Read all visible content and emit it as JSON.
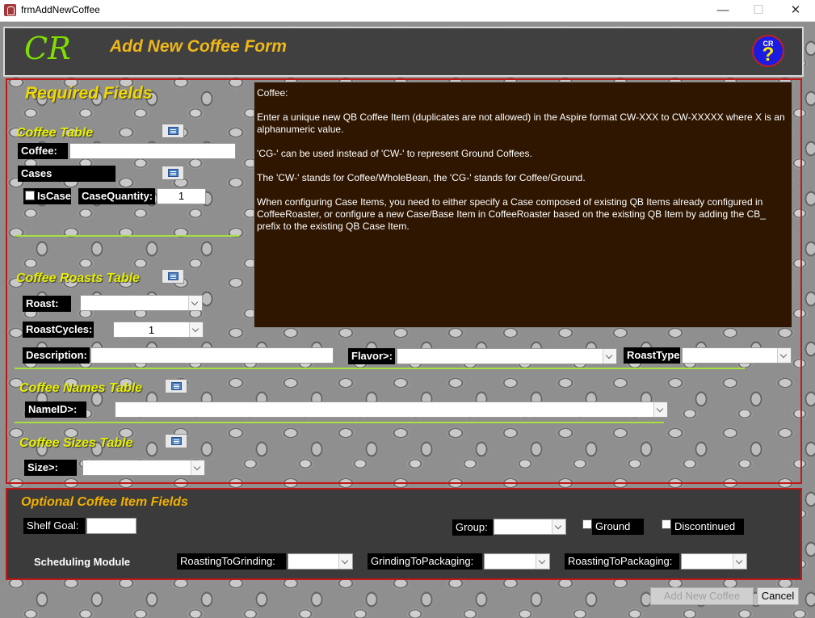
{
  "window": {
    "title": "frmAddNewCoffee",
    "minimize": "—",
    "maximize": "☐",
    "close": "✕"
  },
  "header": {
    "logo": "CR",
    "title": "Add New Coffee Form",
    "help_cr": "CR",
    "help_q": "?"
  },
  "required": {
    "title": "Required Fields",
    "coffee_table": {
      "title": "Coffee Table",
      "coffee_label": "Coffee:",
      "coffee_value": "",
      "cases_label": "Cases",
      "iscase_label": "IsCase",
      "casequantity_label": "CaseQuantity:",
      "casequantity_value": "1"
    },
    "roasts_table": {
      "title": "Coffee Roasts Table",
      "roast_label": "Roast:",
      "roast_value": "",
      "roastcycles_label": "RoastCycles:",
      "roastcycles_value": "1",
      "description_label": "Description:",
      "description_value": "",
      "flavor_label": "Flavor>:",
      "flavor_value": "",
      "roasttype_label": "RoastType",
      "roasttype_value": ""
    },
    "names_table": {
      "title": "Coffee Names Table",
      "nameid_label": "NameID>:",
      "nameid_value": ""
    },
    "sizes_table": {
      "title": "Coffee Sizes Table",
      "size_label": "Size>:",
      "size_value": ""
    }
  },
  "help_text": [
    "Coffee:",
    "Enter a unique new QB Coffee Item (duplicates are not allowed) in the Aspire format CW-XXX to CW-XXXXX where X is an alphanumeric value.",
    "'CG-' can be used instead of 'CW-' to represent Ground Coffees.",
    "The 'CW-' stands for Coffee/WholeBean, the 'CG-' stands for Coffee/Ground.",
    "When configuring Case Items, you need to either specify a Case composed of existing QB Items already configured in CoffeeRoaster, or configure a new Case/Base Item in CoffeeRoaster based on the existing QB Item by adding the CB_ prefix to the existing QB Case Item."
  ],
  "optional": {
    "title": "Optional Coffee Item Fields",
    "shelf_goal_label": "Shelf Goal:",
    "shelf_goal_value": "",
    "group_label": "Group:",
    "group_value": "",
    "ground_label": "Ground",
    "discontinued_label": "Discontinued",
    "scheduling_label": "Scheduling Module",
    "r2g_label": "RoastingToGrinding:",
    "g2p_label": "GrindingToPackaging:",
    "r2p_label": "RoastingToPackaging:"
  },
  "buttons": {
    "add": "Add New Coffee",
    "cancel": "Cancel"
  }
}
